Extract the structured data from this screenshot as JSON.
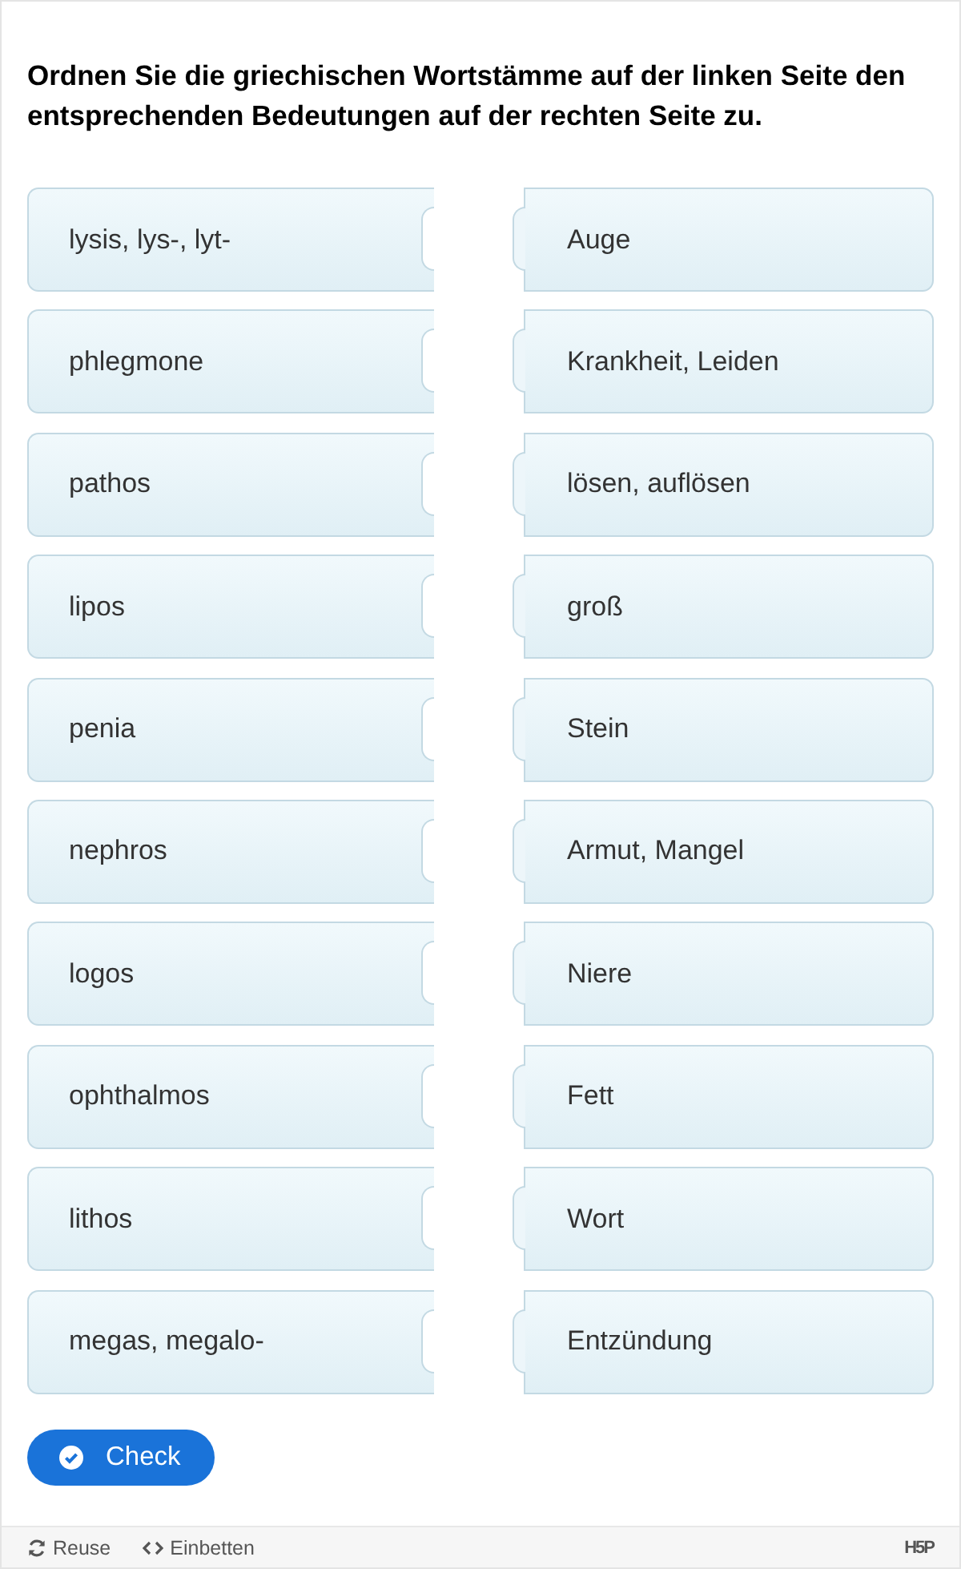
{
  "question": "Ordnen Sie die griechischen Wortstämme auf der linken Seite den entsprechenden Bedeutungen auf der rechten Seite zu.",
  "pairs": [
    {
      "term": "lysis, lys-, lyt-",
      "meaning": "Auge"
    },
    {
      "term": "phlegmone",
      "meaning": "Krankheit, Leiden"
    },
    {
      "term": "pathos",
      "meaning": "lösen, auflösen"
    },
    {
      "term": "lipos",
      "meaning": "groß"
    },
    {
      "term": "penia",
      "meaning": "Stein"
    },
    {
      "term": "nephros",
      "meaning": "Armut, Mangel"
    },
    {
      "term": "logos",
      "meaning": "Niere"
    },
    {
      "term": "ophthalmos",
      "meaning": "Fett"
    },
    {
      "term": "lithos",
      "meaning": "Wort"
    },
    {
      "term": "megas, megalo-",
      "meaning": "Entzündung"
    }
  ],
  "check_button": "Check",
  "footer": {
    "links": [
      "Reuse",
      "Einbetten"
    ],
    "logo": "H5P"
  }
}
